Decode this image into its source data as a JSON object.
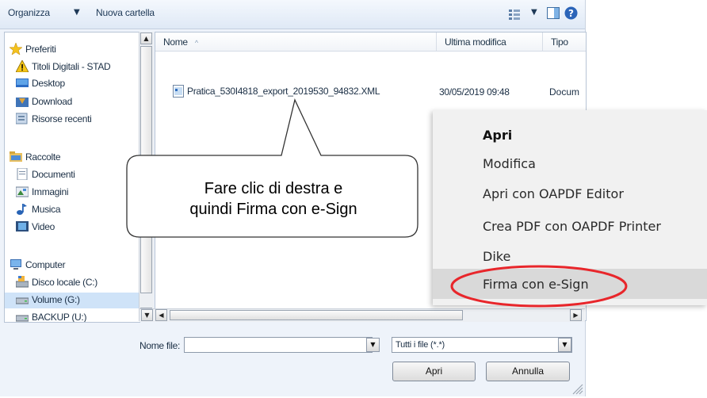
{
  "toolbar": {
    "organize_label": "Organizza",
    "new_folder_label": "Nuova cartella"
  },
  "nav": {
    "favorites_header": "Preferiti",
    "favorites": [
      "Titoli Digitali - STAD",
      "Desktop",
      "Download",
      "Risorse recenti"
    ],
    "libraries_header": "Raccolte",
    "libraries": [
      "Documenti",
      "Immagini",
      "Musica",
      "Video"
    ],
    "computer_header": "Computer",
    "drives": [
      "Disco locale (C:)",
      "Volume (G:)",
      "BACKUP (U:)"
    ],
    "selected": "Volume (G:)"
  },
  "columns": {
    "name": "Nome",
    "modified": "Ultima modifica",
    "type": "Tipo"
  },
  "file": {
    "name": "Pratica_530I4818_export_2019530_94832.XML",
    "date": "30/05/2019 09:48",
    "type": "Docum"
  },
  "bottom": {
    "filename_label": "Nome file:",
    "filename_value": "",
    "filter_value": "Tutti i file (*.*)",
    "open_button": "Apri",
    "cancel_button": "Annulla"
  },
  "context_menu": {
    "items": [
      "Apri",
      "Modifica",
      "Apri con OAPDF Editor",
      "Crea PDF con OAPDF Printer",
      "Dike",
      "Firma con e-Sign"
    ],
    "highlighted": "Firma con e-Sign",
    "circle_color": "#e8262b"
  },
  "callout": {
    "line1": "Fare clic di destra e",
    "line2": "quindi Firma con e-Sign"
  }
}
